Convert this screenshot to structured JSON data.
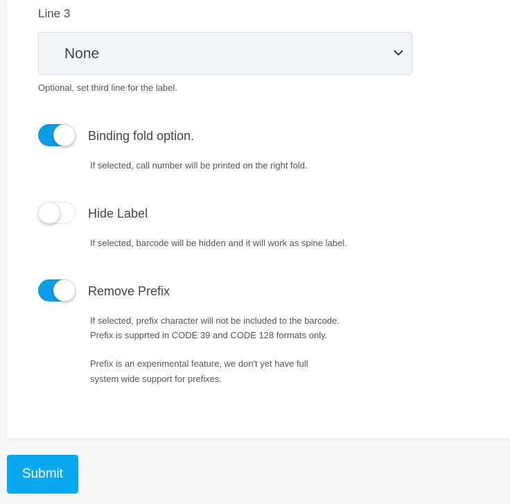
{
  "line3": {
    "label": "Line 3",
    "selected": "None",
    "help": "Optional, set third line for the label."
  },
  "toggles": [
    {
      "title": "Binding fold option.",
      "state": "on",
      "help": [
        "If selected, call number will be printed on the right fold."
      ]
    },
    {
      "title": "Hide Label",
      "state": "off",
      "help": [
        "If selected, barcode will be hidden and it will work as spine label."
      ]
    },
    {
      "title": "Remove Prefix",
      "state": "on",
      "help": [
        "If selected, prefix character will not be included to the barcode.",
        "Prefix is supprted in CODE 39 and CODE 128 formats only.",
        "Prefix is an experimental feature, we don't yet have full",
        "system wide support for prefixes."
      ]
    }
  ],
  "submit_label": "Submit",
  "colors": {
    "toggle_on": "#0d9de6",
    "button": "#0aa8f0"
  }
}
